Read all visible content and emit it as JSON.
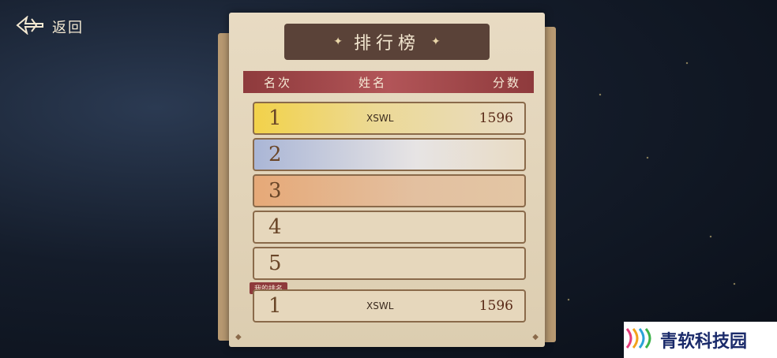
{
  "back": {
    "label": "返回"
  },
  "leaderboard": {
    "title": "排行榜",
    "headers": {
      "rank": "名次",
      "name": "姓名",
      "score": "分数"
    },
    "rows": [
      {
        "rank": "1",
        "name": "XSWL",
        "score": "1596"
      },
      {
        "rank": "2",
        "name": "",
        "score": ""
      },
      {
        "rank": "3",
        "name": "",
        "score": ""
      },
      {
        "rank": "4",
        "name": "",
        "score": ""
      },
      {
        "rank": "5",
        "name": "",
        "score": ""
      }
    ],
    "my_rank": {
      "tag": "我的排名",
      "rank": "1",
      "name": "XSWL",
      "score": "1596"
    }
  },
  "watermark": {
    "label": "青软科技园"
  }
}
